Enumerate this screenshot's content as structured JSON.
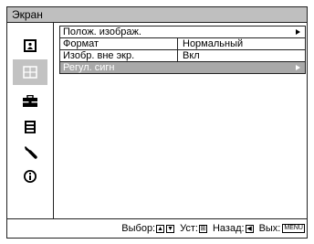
{
  "window": {
    "title": "Экран"
  },
  "sidebar": {
    "items": [
      {
        "icon": "picture-icon"
      },
      {
        "icon": "screen-icon",
        "selected": true
      },
      {
        "icon": "setup-toolbox-icon"
      },
      {
        "icon": "menu-settings-icon"
      },
      {
        "icon": "wrench-icon"
      },
      {
        "icon": "info-icon"
      }
    ]
  },
  "menu": {
    "rows": [
      {
        "label": "Полож. изображ.",
        "value": "",
        "has_arrow": true
      },
      {
        "label": "Формат",
        "value": "Нормальный",
        "has_arrow": false
      },
      {
        "label": "Изобр. вне экр.",
        "value": "Вкл",
        "has_arrow": false
      },
      {
        "label": "Регул. сигн",
        "value": "",
        "has_arrow": true,
        "selected": true
      }
    ]
  },
  "footer": {
    "select_label": "Выбор:",
    "set_label": "Уст:",
    "back_label": "Назад:",
    "exit_label": "Вых:",
    "menu_key": "MENU",
    "up_key": "▲",
    "down_key": "▼",
    "enter_key": "⊞",
    "left_key": "◀"
  },
  "colors": {
    "selected_bg": "#a9a9a9",
    "title_bg": "#bfbfbf",
    "icon_sel_bg": "#c2c2c2"
  }
}
